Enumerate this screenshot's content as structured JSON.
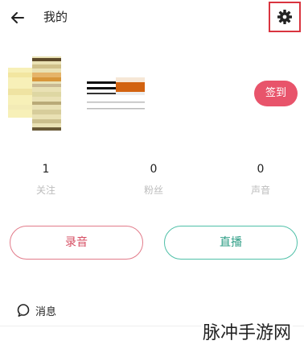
{
  "header": {
    "back_icon": "arrow-left-icon",
    "title": "我的",
    "settings_icon": "gear-icon",
    "settings_highlight_color": "#d9343f"
  },
  "profile": {
    "checkin_label": "签到",
    "checkin_color": "#e8546b"
  },
  "stats": [
    {
      "value": "1",
      "label": "关注"
    },
    {
      "value": "0",
      "label": "粉丝"
    },
    {
      "value": "0",
      "label": "声音"
    }
  ],
  "actions": {
    "record_label": "录音",
    "record_color": "#d64d62",
    "live_label": "直播",
    "live_color": "#2f9e86"
  },
  "menu": {
    "messages_icon": "chat-bubble-icon",
    "messages_label": "消息"
  },
  "watermark": "脉冲手游网"
}
